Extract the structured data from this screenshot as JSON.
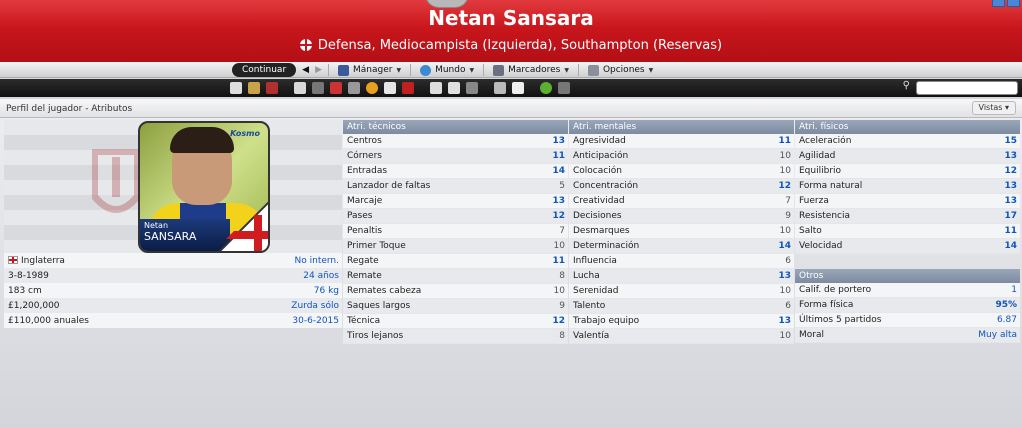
{
  "header": {
    "title": "Netan Sansara",
    "subtitle": "Defensa, Mediocampista (Izquierda), Southampton (Reservas)"
  },
  "nav": {
    "continue": "Continuar",
    "manager": "Mánager",
    "world": "Mundo",
    "bookmarks": "Marcadores",
    "options": "Opciones"
  },
  "panel": {
    "title": "Perfil del jugador - Atributos",
    "views": "Vistas"
  },
  "player": {
    "first_name": "Netan",
    "last_name": "SANSARA",
    "photo_brand": "Kosmo"
  },
  "info": [
    {
      "label": "Inglaterra",
      "value": "No intern."
    },
    {
      "label": "3-8-1989",
      "value": "24 años"
    },
    {
      "label": "183 cm",
      "value": "76 kg"
    },
    {
      "label": "£1,200,000",
      "value": "Zurda sólo"
    },
    {
      "label": "£110,000 anuales",
      "value": "30-6-2015"
    }
  ],
  "technical": {
    "title": "Atri. técnicos",
    "rows": [
      {
        "label": "Centros",
        "value": "13"
      },
      {
        "label": "Córners",
        "value": "11"
      },
      {
        "label": "Entradas",
        "value": "14"
      },
      {
        "label": "Lanzador de faltas",
        "value": "5"
      },
      {
        "label": "Marcaje",
        "value": "13"
      },
      {
        "label": "Pases",
        "value": "12"
      },
      {
        "label": "Penaltis",
        "value": "7"
      },
      {
        "label": "Primer Toque",
        "value": "10"
      },
      {
        "label": "Regate",
        "value": "11"
      },
      {
        "label": "Remate",
        "value": "8"
      },
      {
        "label": "Remates cabeza",
        "value": "10"
      },
      {
        "label": "Saques largos",
        "value": "9"
      },
      {
        "label": "Técnica",
        "value": "12"
      },
      {
        "label": "Tiros lejanos",
        "value": "8"
      }
    ]
  },
  "mental": {
    "title": "Atri. mentales",
    "rows": [
      {
        "label": "Agresividad",
        "value": "11"
      },
      {
        "label": "Anticipación",
        "value": "10"
      },
      {
        "label": "Colocación",
        "value": "10"
      },
      {
        "label": "Concentración",
        "value": "12"
      },
      {
        "label": "Creatividad",
        "value": "7"
      },
      {
        "label": "Decisiones",
        "value": "9"
      },
      {
        "label": "Desmarques",
        "value": "10"
      },
      {
        "label": "Determinación",
        "value": "14"
      },
      {
        "label": "Influencia",
        "value": "6"
      },
      {
        "label": "Lucha",
        "value": "13"
      },
      {
        "label": "Serenidad",
        "value": "10"
      },
      {
        "label": "Talento",
        "value": "6"
      },
      {
        "label": "Trabajo equipo",
        "value": "13"
      },
      {
        "label": "Valentía",
        "value": "10"
      }
    ]
  },
  "physical": {
    "title": "Atri. físicos",
    "rows": [
      {
        "label": "Aceleración",
        "value": "15"
      },
      {
        "label": "Agilidad",
        "value": "13"
      },
      {
        "label": "Equilibrio",
        "value": "12"
      },
      {
        "label": "Forma natural",
        "value": "13"
      },
      {
        "label": "Fuerza",
        "value": "13"
      },
      {
        "label": "Resistencia",
        "value": "17"
      },
      {
        "label": "Salto",
        "value": "11"
      },
      {
        "label": "Velocidad",
        "value": "14"
      }
    ]
  },
  "others": {
    "title": "Otros",
    "rows": [
      {
        "label": "Calif. de portero",
        "value": "1"
      },
      {
        "label": "Forma física",
        "value": "95%"
      },
      {
        "label": "Últimos 5 partidos",
        "value": "6.87"
      },
      {
        "label": "Moral",
        "value": "Muy alta"
      }
    ]
  },
  "colors": {
    "header_red": "#c8161c",
    "accent_blue": "#1155bb",
    "column_header": "#8a97ad"
  }
}
